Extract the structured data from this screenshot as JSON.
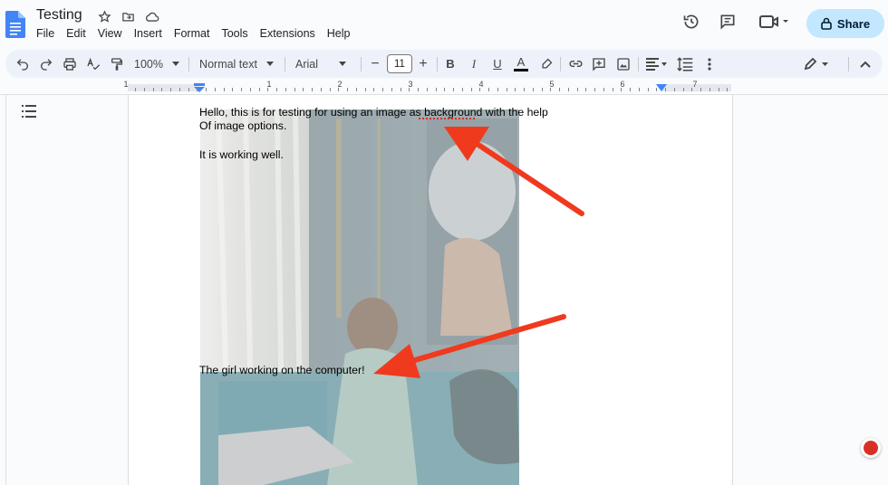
{
  "header": {
    "title": "Testing",
    "menu": [
      "File",
      "Edit",
      "View",
      "Insert",
      "Format",
      "Tools",
      "Extensions",
      "Help"
    ],
    "share_label": "Share",
    "share_color": "#c2e7ff"
  },
  "toolbar": {
    "zoom": "100%",
    "style": "Normal text",
    "font": "Arial",
    "font_size": "11",
    "minus": "−",
    "plus": "+"
  },
  "ruler": {
    "numbers": [
      "1",
      "1",
      "2",
      "3",
      "4",
      "5",
      "6",
      "7"
    ]
  },
  "document": {
    "line1": "Hello, this is for testing for using an image as background with the help",
    "line2": "Of image options.",
    "line3": "It is working well.",
    "line4": "The girl working on the computer!",
    "spell_underline_word": "background",
    "annotation_color": "#f03a1e"
  }
}
